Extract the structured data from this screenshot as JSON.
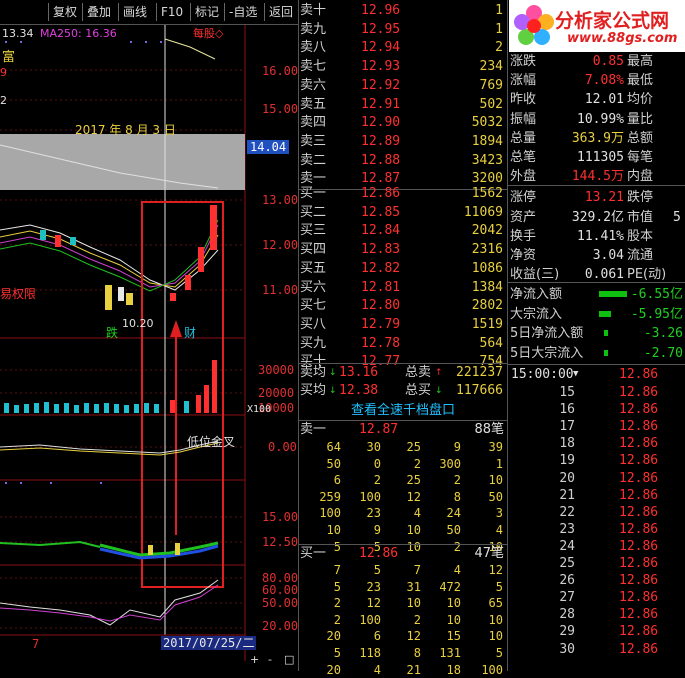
{
  "toolbar": {
    "items": [
      "复权",
      "叠加",
      "画线",
      "F10",
      "标记",
      "-自选",
      "返回"
    ]
  },
  "chart": {
    "price_label": "13.34",
    "ma_label": "MA250: 16.36",
    "mode_label": "每股◇",
    "left_frag_1": "富",
    "left_frag_2": "9",
    "left_frag_3": "2",
    "date_note": "2017 年 8 月 3 日",
    "price_axis": [
      "16.00",
      "15.00",
      "14.04",
      "13.00",
      "12.00",
      "11.00"
    ],
    "low_marker": "10.20",
    "tag_die": "跌",
    "tag_cai": "财",
    "left_note": "易权限",
    "vol_axis": [
      "30000",
      "20000",
      "10000"
    ],
    "vol_unit": "X100",
    "indicator_label": "低位金叉",
    "ind_axis_1": "0.00",
    "ind_axis_2a": "15.00",
    "ind_axis_2b": "12.50",
    "ind_axis_3": [
      "80.00",
      "60.00",
      "50.00",
      "20.00"
    ],
    "date_axis_left": "7",
    "date_cursor": "2017/07/25/二",
    "nav_buttons": [
      "+",
      "-",
      "□"
    ]
  },
  "book": {
    "asks": [
      {
        "label": "卖十",
        "price": "12.96",
        "vol": "1"
      },
      {
        "label": "卖九",
        "price": "12.95",
        "vol": "1"
      },
      {
        "label": "卖八",
        "price": "12.94",
        "vol": "2"
      },
      {
        "label": "卖七",
        "price": "12.93",
        "vol": "234"
      },
      {
        "label": "卖六",
        "price": "12.92",
        "vol": "769"
      },
      {
        "label": "卖五",
        "price": "12.91",
        "vol": "502"
      },
      {
        "label": "卖四",
        "price": "12.90",
        "vol": "5032"
      },
      {
        "label": "卖三",
        "price": "12.89",
        "vol": "1894"
      },
      {
        "label": "卖二",
        "price": "12.88",
        "vol": "3423"
      },
      {
        "label": "卖一",
        "price": "12.87",
        "vol": "3200"
      }
    ],
    "bids": [
      {
        "label": "买一",
        "price": "12.86",
        "vol": "1562"
      },
      {
        "label": "买二",
        "price": "12.85",
        "vol": "11069"
      },
      {
        "label": "买三",
        "price": "12.84",
        "vol": "2042"
      },
      {
        "label": "买四",
        "price": "12.83",
        "vol": "2316"
      },
      {
        "label": "买五",
        "price": "12.82",
        "vol": "1086"
      },
      {
        "label": "买六",
        "price": "12.81",
        "vol": "1384"
      },
      {
        "label": "买七",
        "price": "12.80",
        "vol": "2802"
      },
      {
        "label": "买八",
        "price": "12.79",
        "vol": "1519"
      },
      {
        "label": "买九",
        "price": "12.78",
        "vol": "564"
      },
      {
        "label": "买十",
        "price": "12.77",
        "vol": "754"
      }
    ],
    "avg_ask_label": "卖均",
    "avg_ask": "13.16",
    "total_ask_label": "总卖",
    "total_ask": "221237",
    "avg_bid_label": "买均",
    "avg_bid": "12.38",
    "total_bid_label": "总买",
    "total_bid": "117666",
    "depth_link": "查看全速千档盘口",
    "depth_ask_label": "卖一",
    "depth_ask_price": "12.87",
    "depth_ask_count": "88笔",
    "depth_ask_rows": [
      [
        "64",
        "30",
        "25",
        "9",
        "39"
      ],
      [
        "50",
        "0",
        "2",
        "300",
        "1"
      ],
      [
        "6",
        "2",
        "25",
        "2",
        "10"
      ],
      [
        "259",
        "100",
        "12",
        "8",
        "50"
      ],
      [
        "100",
        "23",
        "4",
        "24",
        "3"
      ],
      [
        "10",
        "9",
        "10",
        "50",
        "4"
      ],
      [
        "5",
        "5",
        "10",
        "2",
        "10"
      ]
    ],
    "depth_bid_label": "买一",
    "depth_bid_price": "12.86",
    "depth_bid_count": "47笔",
    "depth_bid_rows": [
      [
        "7",
        "5",
        "7",
        "4",
        "12"
      ],
      [
        "5",
        "23",
        "31",
        "472",
        "5"
      ],
      [
        "2",
        "12",
        "10",
        "10",
        "65"
      ],
      [
        "2",
        "100",
        "2",
        "10",
        "10"
      ],
      [
        "20",
        "6",
        "12",
        "15",
        "10"
      ],
      [
        "5",
        "118",
        "8",
        "131",
        "5"
      ],
      [
        "20",
        "4",
        "21",
        "18",
        "100"
      ]
    ]
  },
  "logo": {
    "title": "分析家公式网",
    "url": "www.88gs.com"
  },
  "stats": {
    "rows": [
      {
        "l1": "涨跌",
        "v1": "0.85",
        "l2": "最高",
        "v2": ""
      },
      {
        "l1": "涨幅",
        "v1": "7.08%",
        "l2": "最低",
        "v2": ""
      },
      {
        "l1": "昨收",
        "v1": "12.01",
        "l2": "均价",
        "v2": ""
      },
      {
        "l1": "振幅",
        "v1": "10.99%",
        "l2": "量比",
        "v2": ""
      },
      {
        "l1": "总量",
        "v1": "363.9万",
        "l2": "总额",
        "v2": ""
      },
      {
        "l1": "总笔",
        "v1": "111305",
        "l2": "每笔",
        "v2": ""
      },
      {
        "l1": "外盘",
        "v1": "144.5万",
        "l2": "内盘",
        "v2": ""
      },
      {
        "l1": "涨停",
        "v1": "13.21",
        "l2": "跌停",
        "v2": ""
      },
      {
        "l1": "资产",
        "v1": "329.2亿",
        "l2": "市值",
        "v2": "5"
      },
      {
        "l1": "换手",
        "v1": "11.41%",
        "l2": "股本",
        "v2": ""
      },
      {
        "l1": "净资",
        "v1": "3.04",
        "l2": "流通",
        "v2": ""
      },
      {
        "l1": "收益(三)",
        "v1": "0.061",
        "l2": "PE(动)",
        "v2": ""
      }
    ]
  },
  "flows": [
    {
      "label": "净流入额",
      "value": "-6.55亿",
      "bar": 0.35
    },
    {
      "label": "大宗流入",
      "value": "-5.95亿",
      "bar": 0.15
    },
    {
      "label": "5日净流入额",
      "value": "-3.26",
      "bar": 0.05
    },
    {
      "label": "5日大宗流入",
      "value": "-2.70",
      "bar": 0.05
    }
  ],
  "ticks": {
    "header_time": "15:00:00",
    "header_price": "12.86",
    "rows": [
      {
        "t": "15",
        "p": "12.86"
      },
      {
        "t": "16",
        "p": "12.86"
      },
      {
        "t": "17",
        "p": "12.86"
      },
      {
        "t": "18",
        "p": "12.86"
      },
      {
        "t": "19",
        "p": "12.86"
      },
      {
        "t": "20",
        "p": "12.86"
      },
      {
        "t": "21",
        "p": "12.86"
      },
      {
        "t": "22",
        "p": "12.86"
      },
      {
        "t": "23",
        "p": "12.86"
      },
      {
        "t": "24",
        "p": "12.86"
      },
      {
        "t": "25",
        "p": "12.86"
      },
      {
        "t": "26",
        "p": "12.86"
      },
      {
        "t": "27",
        "p": "12.86"
      },
      {
        "t": "28",
        "p": "12.86"
      },
      {
        "t": "29",
        "p": "12.86"
      },
      {
        "t": "30",
        "p": "12.86"
      }
    ]
  },
  "colors": {
    "up": "#ff3030",
    "down": "#20d020",
    "volume": "#e8d040",
    "highlight_box": "#e02020"
  }
}
